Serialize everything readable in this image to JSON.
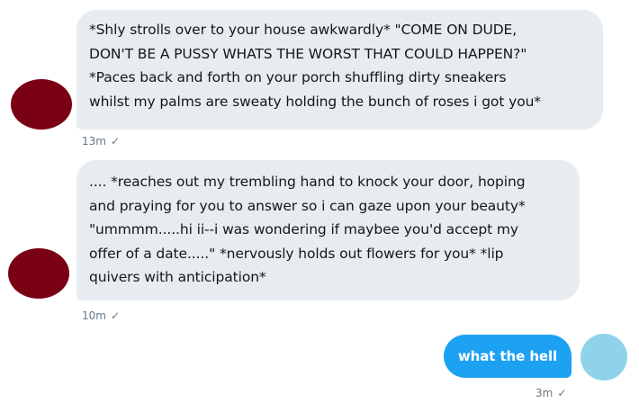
{
  "conversation": {
    "messages": [
      {
        "sender": "other",
        "lines": [
          "*Shly strolls over to your house awkwardly* \"COME ON DUDE,",
          "DON'T BE A PUSSY WHATS THE WORST THAT COULD HAPPEN?\"",
          "*Paces back and forth on your porch shuffling dirty sneakers",
          "whilst my palms are sweaty holding the bunch of roses i got you*"
        ],
        "time": "13m",
        "status_icon": "check-icon"
      },
      {
        "sender": "other",
        "lines": [
          ".... *reaches out my trembling hand to knock your door, hoping",
          "and praying for you to answer so i can gaze upon your beauty*",
          "\"ummmm.....hi ii--i was wondering if maybee you'd accept my",
          "offer of a date.....\" *nervously holds out flowers for you* *lip",
          "quivers with anticipation*"
        ],
        "time": "10m",
        "status_icon": "check-icon"
      },
      {
        "sender": "me",
        "text": "what the hell",
        "time": "3m",
        "status_icon": "check-icon"
      }
    ],
    "check_glyph": "✓",
    "colors": {
      "incoming_bubble": "#e6ecf0",
      "outgoing_bubble": "#1da1f2",
      "other_avatar": "#7a0014",
      "my_avatar": "#8fd3ea",
      "meta_text": "#657786"
    }
  }
}
